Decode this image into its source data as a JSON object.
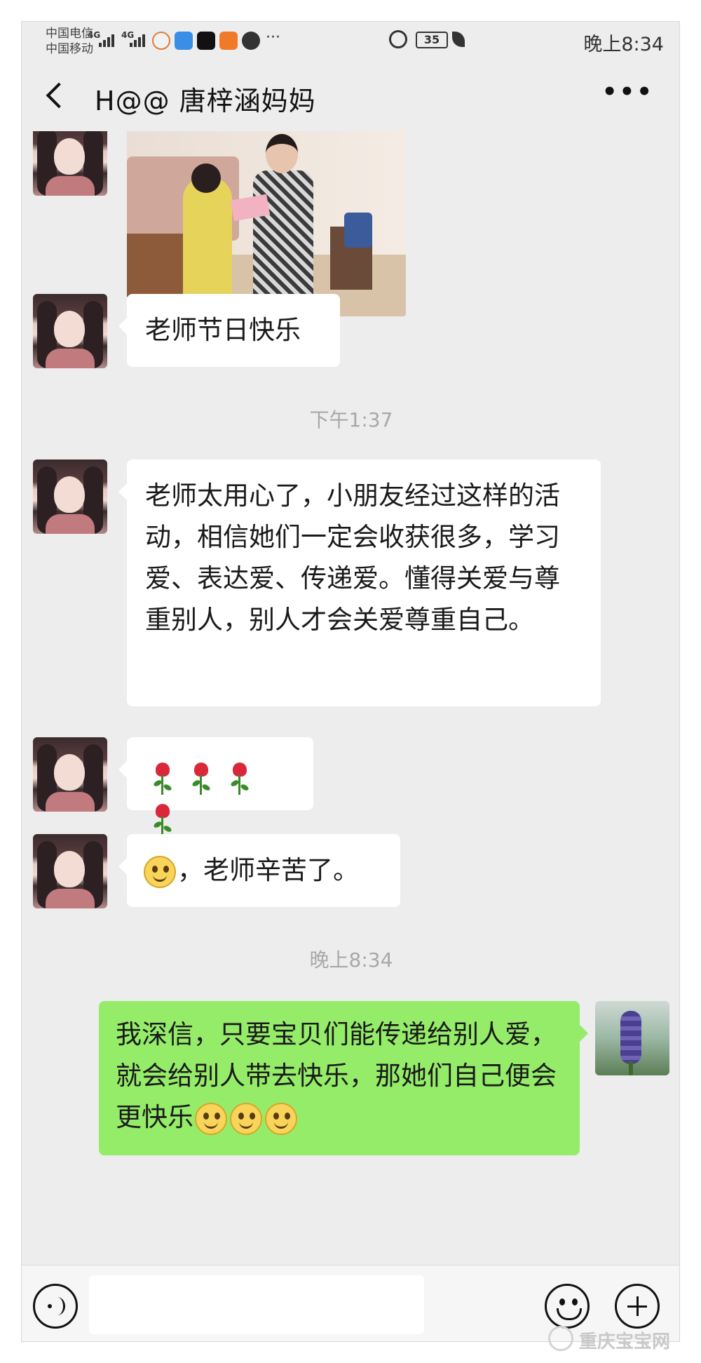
{
  "status_bar": {
    "carrier_1": "中国电信",
    "carrier_2": "中国移动",
    "network_1": "4G",
    "network_2": "4G",
    "battery": "35",
    "time": "晚上8:34",
    "more": "···"
  },
  "header": {
    "title": "H@@  唐梓涵妈妈",
    "back_icon": "chevron-left-icon",
    "more_icon": "more-horizontal-icon"
  },
  "messages": [
    {
      "type": "image",
      "sender": "other"
    },
    {
      "type": "text",
      "sender": "other",
      "text": "老师节日快乐"
    },
    {
      "type": "time",
      "text": "下午1:37"
    },
    {
      "type": "text",
      "sender": "other",
      "text": "老师太用心了，小朋友经过这样的活动，相信她们一定会收获很多，学习爱、表达爱、传递爱。懂得关爱与尊重别人，别人才会关爱尊重自己。"
    },
    {
      "type": "emoji",
      "sender": "other",
      "emoji": "rose-emoji",
      "count": 4
    },
    {
      "type": "text",
      "sender": "other",
      "text": "，老师辛苦了。",
      "leading_emoji": "smile-emoji"
    },
    {
      "type": "time",
      "text": "晚上8:34"
    },
    {
      "type": "text",
      "sender": "me",
      "text": "我深信，只要宝贝们能传递给别人爱，就会给别人带去快乐，那她们自己便会更快乐",
      "trailing_emoji": "smile-emoji",
      "trailing_count": 3
    }
  ],
  "input_bar": {
    "voice_icon": "voice-icon",
    "emoji_icon": "emoji-icon",
    "plus_icon": "plus-icon"
  },
  "watermark": "重庆宝宝网",
  "colors": {
    "chat_bg": "#ededed",
    "bubble_other": "#ffffff",
    "bubble_me": "#95ec69"
  }
}
